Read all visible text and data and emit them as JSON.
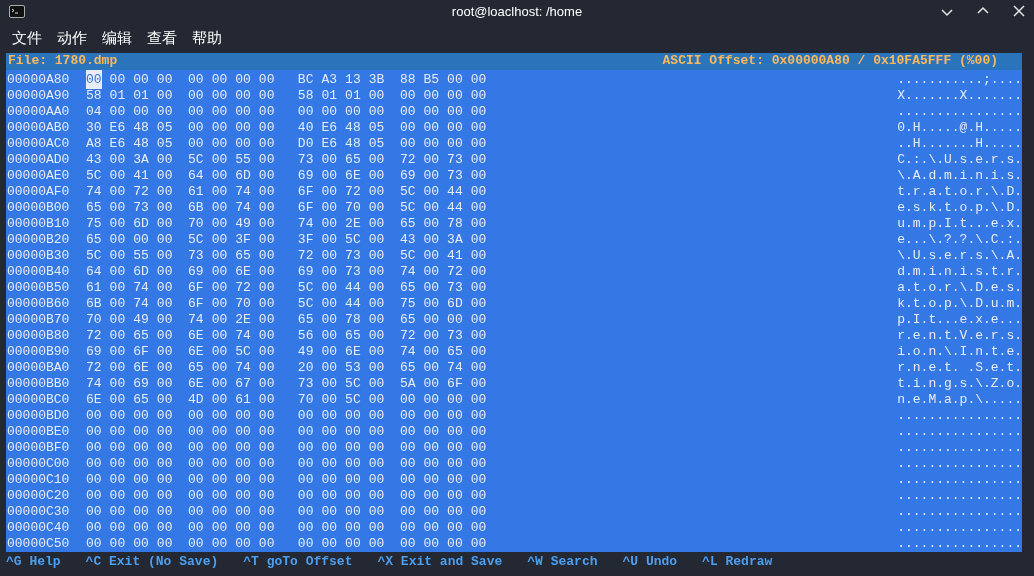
{
  "window": {
    "title": "root@loaclhost: /home"
  },
  "menu": [
    "文件",
    "动作",
    "编辑",
    "查看",
    "帮助"
  ],
  "header": {
    "file": "File: 1780.dmp",
    "offset": "ASCII Offset: 0x00000A80 / 0x10FA5FFF (%00)"
  },
  "rows": [
    {
      "offset": "00000A80",
      "bytes": [
        "00",
        "00",
        "00",
        "00",
        "00",
        "00",
        "00",
        "00",
        "BC",
        "A3",
        "13",
        "3B",
        "88",
        "B5",
        "00",
        "00"
      ],
      "ascii": "...........;....",
      "cursor": true
    },
    {
      "offset": "00000A90",
      "bytes": [
        "58",
        "01",
        "01",
        "00",
        "00",
        "00",
        "00",
        "00",
        "58",
        "01",
        "01",
        "00",
        "00",
        "00",
        "00",
        "00"
      ],
      "ascii": "X.......X.......",
      "cursor": false
    },
    {
      "offset": "00000AA0",
      "bytes": [
        "04",
        "00",
        "00",
        "00",
        "00",
        "00",
        "00",
        "00",
        "00",
        "00",
        "00",
        "00",
        "00",
        "00",
        "00",
        "00"
      ],
      "ascii": "................",
      "cursor": false
    },
    {
      "offset": "00000AB0",
      "bytes": [
        "30",
        "E6",
        "48",
        "05",
        "00",
        "00",
        "00",
        "00",
        "40",
        "E6",
        "48",
        "05",
        "00",
        "00",
        "00",
        "00"
      ],
      "ascii": "0.H.....@.H.....",
      "cursor": false
    },
    {
      "offset": "00000AC0",
      "bytes": [
        "A8",
        "E6",
        "48",
        "05",
        "00",
        "00",
        "00",
        "00",
        "D0",
        "E6",
        "48",
        "05",
        "00",
        "00",
        "00",
        "00"
      ],
      "ascii": "..H.......H.....",
      "cursor": false
    },
    {
      "offset": "00000AD0",
      "bytes": [
        "43",
        "00",
        "3A",
        "00",
        "5C",
        "00",
        "55",
        "00",
        "73",
        "00",
        "65",
        "00",
        "72",
        "00",
        "73",
        "00"
      ],
      "ascii": "C.:.\\.U.s.e.r.s.",
      "cursor": false
    },
    {
      "offset": "00000AE0",
      "bytes": [
        "5C",
        "00",
        "41",
        "00",
        "64",
        "00",
        "6D",
        "00",
        "69",
        "00",
        "6E",
        "00",
        "69",
        "00",
        "73",
        "00"
      ],
      "ascii": "\\.A.d.m.i.n.i.s.",
      "cursor": false
    },
    {
      "offset": "00000AF0",
      "bytes": [
        "74",
        "00",
        "72",
        "00",
        "61",
        "00",
        "74",
        "00",
        "6F",
        "00",
        "72",
        "00",
        "5C",
        "00",
        "44",
        "00"
      ],
      "ascii": "t.r.a.t.o.r.\\.D.",
      "cursor": false
    },
    {
      "offset": "00000B00",
      "bytes": [
        "65",
        "00",
        "73",
        "00",
        "6B",
        "00",
        "74",
        "00",
        "6F",
        "00",
        "70",
        "00",
        "5C",
        "00",
        "44",
        "00"
      ],
      "ascii": "e.s.k.t.o.p.\\.D.",
      "cursor": false
    },
    {
      "offset": "00000B10",
      "bytes": [
        "75",
        "00",
        "6D",
        "00",
        "70",
        "00",
        "49",
        "00",
        "74",
        "00",
        "2E",
        "00",
        "65",
        "00",
        "78",
        "00"
      ],
      "ascii": "u.m.p.I.t...e.x.",
      "cursor": false
    },
    {
      "offset": "00000B20",
      "bytes": [
        "65",
        "00",
        "00",
        "00",
        "5C",
        "00",
        "3F",
        "00",
        "3F",
        "00",
        "5C",
        "00",
        "43",
        "00",
        "3A",
        "00"
      ],
      "ascii": "e...\\.?.?.\\.C.:.",
      "cursor": false
    },
    {
      "offset": "00000B30",
      "bytes": [
        "5C",
        "00",
        "55",
        "00",
        "73",
        "00",
        "65",
        "00",
        "72",
        "00",
        "73",
        "00",
        "5C",
        "00",
        "41",
        "00"
      ],
      "ascii": "\\.U.s.e.r.s.\\.A.",
      "cursor": false
    },
    {
      "offset": "00000B40",
      "bytes": [
        "64",
        "00",
        "6D",
        "00",
        "69",
        "00",
        "6E",
        "00",
        "69",
        "00",
        "73",
        "00",
        "74",
        "00",
        "72",
        "00"
      ],
      "ascii": "d.m.i.n.i.s.t.r.",
      "cursor": false
    },
    {
      "offset": "00000B50",
      "bytes": [
        "61",
        "00",
        "74",
        "00",
        "6F",
        "00",
        "72",
        "00",
        "5C",
        "00",
        "44",
        "00",
        "65",
        "00",
        "73",
        "00"
      ],
      "ascii": "a.t.o.r.\\.D.e.s.",
      "cursor": false
    },
    {
      "offset": "00000B60",
      "bytes": [
        "6B",
        "00",
        "74",
        "00",
        "6F",
        "00",
        "70",
        "00",
        "5C",
        "00",
        "44",
        "00",
        "75",
        "00",
        "6D",
        "00"
      ],
      "ascii": "k.t.o.p.\\.D.u.m.",
      "cursor": false
    },
    {
      "offset": "00000B70",
      "bytes": [
        "70",
        "00",
        "49",
        "00",
        "74",
        "00",
        "2E",
        "00",
        "65",
        "00",
        "78",
        "00",
        "65",
        "00",
        "00",
        "00"
      ],
      "ascii": "p.I.t...e.x.e...",
      "cursor": false
    },
    {
      "offset": "00000B80",
      "bytes": [
        "72",
        "00",
        "65",
        "00",
        "6E",
        "00",
        "74",
        "00",
        "56",
        "00",
        "65",
        "00",
        "72",
        "00",
        "73",
        "00"
      ],
      "ascii": "r.e.n.t.V.e.r.s.",
      "cursor": false
    },
    {
      "offset": "00000B90",
      "bytes": [
        "69",
        "00",
        "6F",
        "00",
        "6E",
        "00",
        "5C",
        "00",
        "49",
        "00",
        "6E",
        "00",
        "74",
        "00",
        "65",
        "00"
      ],
      "ascii": "i.o.n.\\.I.n.t.e.",
      "cursor": false
    },
    {
      "offset": "00000BA0",
      "bytes": [
        "72",
        "00",
        "6E",
        "00",
        "65",
        "00",
        "74",
        "00",
        "20",
        "00",
        "53",
        "00",
        "65",
        "00",
        "74",
        "00"
      ],
      "ascii": "r.n.e.t. .S.e.t.",
      "cursor": false
    },
    {
      "offset": "00000BB0",
      "bytes": [
        "74",
        "00",
        "69",
        "00",
        "6E",
        "00",
        "67",
        "00",
        "73",
        "00",
        "5C",
        "00",
        "5A",
        "00",
        "6F",
        "00"
      ],
      "ascii": "t.i.n.g.s.\\.Z.o.",
      "cursor": false
    },
    {
      "offset": "00000BC0",
      "bytes": [
        "6E",
        "00",
        "65",
        "00",
        "4D",
        "00",
        "61",
        "00",
        "70",
        "00",
        "5C",
        "00",
        "00",
        "00",
        "00",
        "00"
      ],
      "ascii": "n.e.M.a.p.\\.....",
      "cursor": false
    },
    {
      "offset": "00000BD0",
      "bytes": [
        "00",
        "00",
        "00",
        "00",
        "00",
        "00",
        "00",
        "00",
        "00",
        "00",
        "00",
        "00",
        "00",
        "00",
        "00",
        "00"
      ],
      "ascii": "................",
      "cursor": false
    },
    {
      "offset": "00000BE0",
      "bytes": [
        "00",
        "00",
        "00",
        "00",
        "00",
        "00",
        "00",
        "00",
        "00",
        "00",
        "00",
        "00",
        "00",
        "00",
        "00",
        "00"
      ],
      "ascii": "................",
      "cursor": false
    },
    {
      "offset": "00000BF0",
      "bytes": [
        "00",
        "00",
        "00",
        "00",
        "00",
        "00",
        "00",
        "00",
        "00",
        "00",
        "00",
        "00",
        "00",
        "00",
        "00",
        "00"
      ],
      "ascii": "................",
      "cursor": false
    },
    {
      "offset": "00000C00",
      "bytes": [
        "00",
        "00",
        "00",
        "00",
        "00",
        "00",
        "00",
        "00",
        "00",
        "00",
        "00",
        "00",
        "00",
        "00",
        "00",
        "00"
      ],
      "ascii": "................",
      "cursor": false
    },
    {
      "offset": "00000C10",
      "bytes": [
        "00",
        "00",
        "00",
        "00",
        "00",
        "00",
        "00",
        "00",
        "00",
        "00",
        "00",
        "00",
        "00",
        "00",
        "00",
        "00"
      ],
      "ascii": "................",
      "cursor": false
    },
    {
      "offset": "00000C20",
      "bytes": [
        "00",
        "00",
        "00",
        "00",
        "00",
        "00",
        "00",
        "00",
        "00",
        "00",
        "00",
        "00",
        "00",
        "00",
        "00",
        "00"
      ],
      "ascii": "................",
      "cursor": false
    },
    {
      "offset": "00000C30",
      "bytes": [
        "00",
        "00",
        "00",
        "00",
        "00",
        "00",
        "00",
        "00",
        "00",
        "00",
        "00",
        "00",
        "00",
        "00",
        "00",
        "00"
      ],
      "ascii": "................",
      "cursor": false
    },
    {
      "offset": "00000C40",
      "bytes": [
        "00",
        "00",
        "00",
        "00",
        "00",
        "00",
        "00",
        "00",
        "00",
        "00",
        "00",
        "00",
        "00",
        "00",
        "00",
        "00"
      ],
      "ascii": "................",
      "cursor": false
    },
    {
      "offset": "00000C50",
      "bytes": [
        "00",
        "00",
        "00",
        "00",
        "00",
        "00",
        "00",
        "00",
        "00",
        "00",
        "00",
        "00",
        "00",
        "00",
        "00",
        "00"
      ],
      "ascii": "................",
      "cursor": false
    }
  ],
  "shortcuts": [
    "^G Help",
    "^C Exit (No Save)",
    "^T goTo Offset",
    "^X Exit and Save",
    "^W Search",
    "^U Undo",
    "^L Redraw"
  ]
}
